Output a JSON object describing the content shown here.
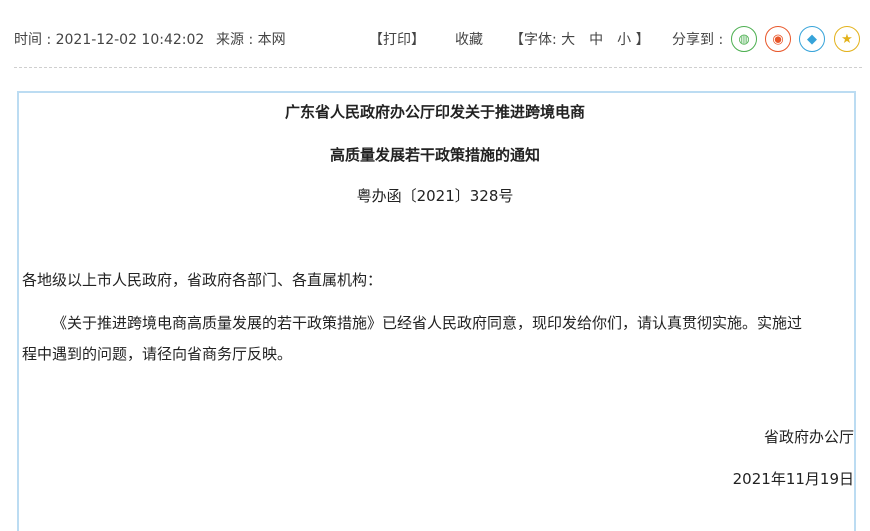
{
  "meta": {
    "time_label": "时间 : 2021-12-02 10:42:02",
    "source_label": "来源 : 本网",
    "print_label": "【打印】",
    "favorite_label": "收藏",
    "font_label": "【字体: 大　中　小 】",
    "share_label": "分享到 :"
  },
  "share": [
    {
      "name": "wechat-icon",
      "color": "#4caf50",
      "glyph": "◍"
    },
    {
      "name": "weibo-icon",
      "color": "#e8572a",
      "glyph": "◉"
    },
    {
      "name": "qq-icon",
      "color": "#36a3d9",
      "glyph": "◆"
    },
    {
      "name": "qzone-icon",
      "color": "#e3b21b",
      "glyph": "★"
    }
  ],
  "document": {
    "title_line1": "广东省人民政府办公厅印发关于推进跨境电商",
    "title_line2": "高质量发展若干政策措施的通知",
    "doc_number": "粤办函〔2021〕328号",
    "salutation": "各地级以上市人民政府，省政府各部门、各直属机构：",
    "body_line1": "《关于推进跨境电商高质量发展的若干政策措施》已经省人民政府同意，现印发给你们，请认真贯彻实施。实施过",
    "body_line2": "程中遇到的问题，请径向省商务厅反映。",
    "signatory": "省政府办公厅",
    "date": "2021年11月19日"
  }
}
